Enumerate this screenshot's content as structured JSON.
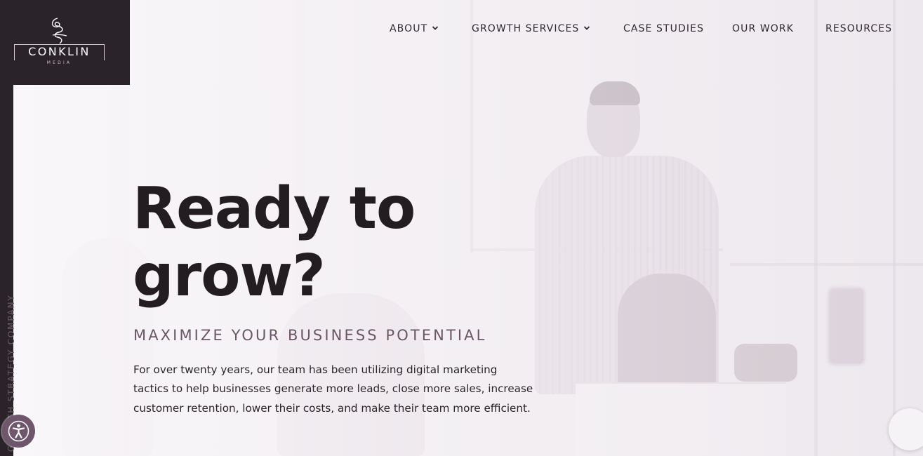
{
  "logo": {
    "name": "CONKLIN",
    "sub": "MEDIA"
  },
  "rail": {
    "text": "GROWTH STRATEGY COMPANY"
  },
  "nav": {
    "items": [
      {
        "label": "ABOUT",
        "has_dropdown": true
      },
      {
        "label": "GROWTH SERVICES",
        "has_dropdown": true
      },
      {
        "label": "CASE STUDIES",
        "has_dropdown": false
      },
      {
        "label": "OUR WORK",
        "has_dropdown": false
      },
      {
        "label": "RESOURCES",
        "has_dropdown": false
      }
    ]
  },
  "hero": {
    "title_line1": "Ready to",
    "title_line2": "grow?",
    "subtitle": "MAXIMIZE YOUR BUSINESS POTENTIAL",
    "body": "For over twenty years, our team has been utilizing digital marketing tactics to help businesses generate more leads, close more sales, increase customer retention, lower their costs, and make their team more efficient."
  },
  "widgets": {
    "accessibility_icon": "accessibility-person-icon",
    "float_icon": "chat-bubble-icon"
  },
  "colors": {
    "dark": "#2a2329",
    "accent": "#70566c",
    "subtitle": "#6b5667",
    "title": "#231d22"
  }
}
